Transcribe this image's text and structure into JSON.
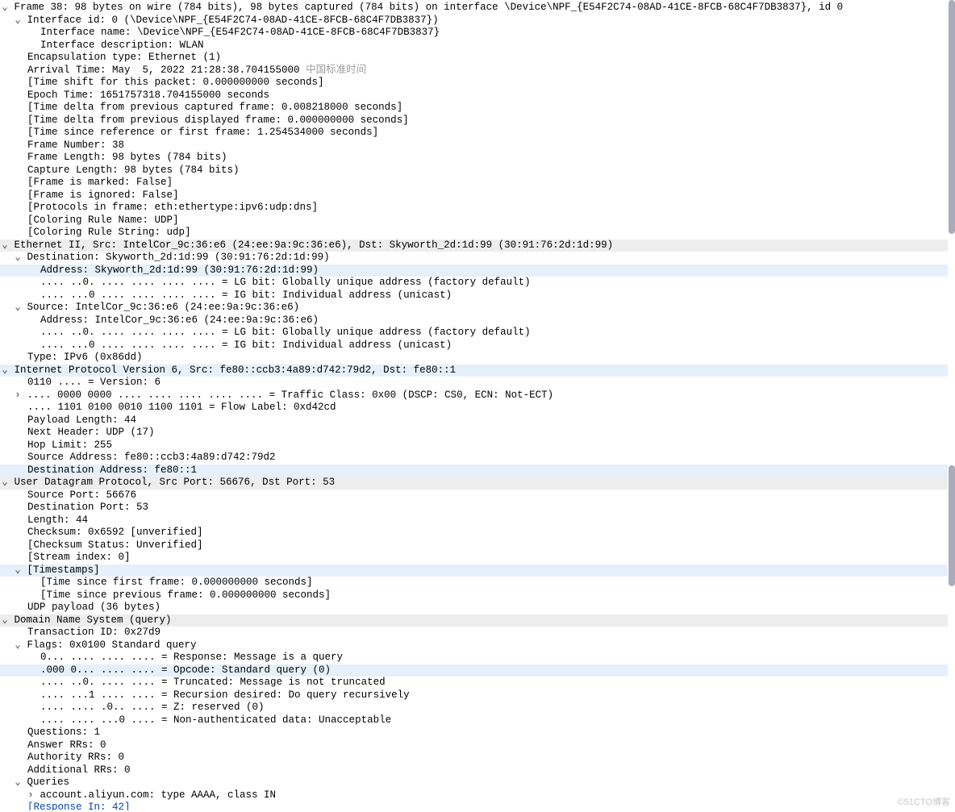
{
  "frame": {
    "summary": "Frame 38: 98 bytes on wire (784 bits), 98 bytes captured (784 bits) on interface \\Device\\NPF_{E54F2C74-08AD-41CE-8FCB-68C4F7DB3837}, id 0",
    "interface_id": "Interface id: 0 (\\Device\\NPF_{E54F2C74-08AD-41CE-8FCB-68C4F7DB3837})",
    "interface_name": "Interface name: \\Device\\NPF_{E54F2C74-08AD-41CE-8FCB-68C4F7DB3837}",
    "interface_desc": "Interface description: WLAN",
    "encap": "Encapsulation type: Ethernet (1)",
    "arrival_prefix": "Arrival Time: May  5, 2022 21:28:38.704155000 ",
    "arrival_tz": "中国标准时间",
    "time_shift": "[Time shift for this packet: 0.000000000 seconds]",
    "epoch": "Epoch Time: 1651757318.704155000 seconds",
    "delta_cap": "[Time delta from previous captured frame: 0.008218000 seconds]",
    "delta_disp": "[Time delta from previous displayed frame: 0.000000000 seconds]",
    "time_ref": "[Time since reference or first frame: 1.254534000 seconds]",
    "number": "Frame Number: 38",
    "len": "Frame Length: 98 bytes (784 bits)",
    "caplen": "Capture Length: 98 bytes (784 bits)",
    "marked": "[Frame is marked: False]",
    "ignored": "[Frame is ignored: False]",
    "protocols": "[Protocols in frame: eth:ethertype:ipv6:udp:dns]",
    "color_name": "[Coloring Rule Name: UDP]",
    "color_string": "[Coloring Rule String: udp]"
  },
  "eth": {
    "summary": "Ethernet II, Src: IntelCor_9c:36:e6 (24:ee:9a:9c:36:e6), Dst: Skyworth_2d:1d:99 (30:91:76:2d:1d:99)",
    "dst_summary": "Destination: Skyworth_2d:1d:99 (30:91:76:2d:1d:99)",
    "dst_addr": "Address: Skyworth_2d:1d:99 (30:91:76:2d:1d:99)",
    "dst_lg": ".... ..0. .... .... .... .... = LG bit: Globally unique address (factory default)",
    "dst_ig": ".... ...0 .... .... .... .... = IG bit: Individual address (unicast)",
    "src_summary": "Source: IntelCor_9c:36:e6 (24:ee:9a:9c:36:e6)",
    "src_addr": "Address: IntelCor_9c:36:e6 (24:ee:9a:9c:36:e6)",
    "src_lg": ".... ..0. .... .... .... .... = LG bit: Globally unique address (factory default)",
    "src_ig": ".... ...0 .... .... .... .... = IG bit: Individual address (unicast)",
    "type": "Type: IPv6 (0x86dd)"
  },
  "ipv6": {
    "summary": "Internet Protocol Version 6, Src: fe80::ccb3:4a89:d742:79d2, Dst: fe80::1",
    "version": "0110 .... = Version: 6",
    "tclass": ".... 0000 0000 .... .... .... .... .... = Traffic Class: 0x00 (DSCP: CS0, ECN: Not-ECT)",
    "flow": ".... 1101 0100 0010 1100 1101 = Flow Label: 0xd42cd",
    "plen": "Payload Length: 44",
    "next": "Next Header: UDP (17)",
    "hop": "Hop Limit: 255",
    "src": "Source Address: fe80::ccb3:4a89:d742:79d2",
    "dst": "Destination Address: fe80::1"
  },
  "udp": {
    "summary": "User Datagram Protocol, Src Port: 56676, Dst Port: 53",
    "srcport": "Source Port: 56676",
    "dstport": "Destination Port: 53",
    "len": "Length: 44",
    "cksum": "Checksum: 0x6592 [unverified]",
    "cksum_status": "[Checksum Status: Unverified]",
    "stream": "[Stream index: 0]",
    "ts": "[Timestamps]",
    "ts_first": "[Time since first frame: 0.000000000 seconds]",
    "ts_prev": "[Time since previous frame: 0.000000000 seconds]",
    "payload": "UDP payload (36 bytes)"
  },
  "dns": {
    "summary": "Domain Name System (query)",
    "txid": "Transaction ID: 0x27d9",
    "flags": "Flags: 0x0100 Standard query",
    "resp": "0... .... .... .... = Response: Message is a query",
    "opcode": ".000 0... .... .... = Opcode: Standard query (0)",
    "trunc": ".... ..0. .... .... = Truncated: Message is not truncated",
    "rd": ".... ...1 .... .... = Recursion desired: Do query recursively",
    "z": ".... .... .0.. .... = Z: reserved (0)",
    "ad": ".... .... ...0 .... = Non-authenticated data: Unacceptable",
    "questions": "Questions: 1",
    "answer_rrs": "Answer RRs: 0",
    "authority_rrs": "Authority RRs: 0",
    "additional_rrs": "Additional RRs: 0",
    "queries": "Queries",
    "query1": "account.aliyun.com: type AAAA, class IN",
    "response_in": "[Response In: 42]"
  },
  "watermark": "©51CTO博客"
}
